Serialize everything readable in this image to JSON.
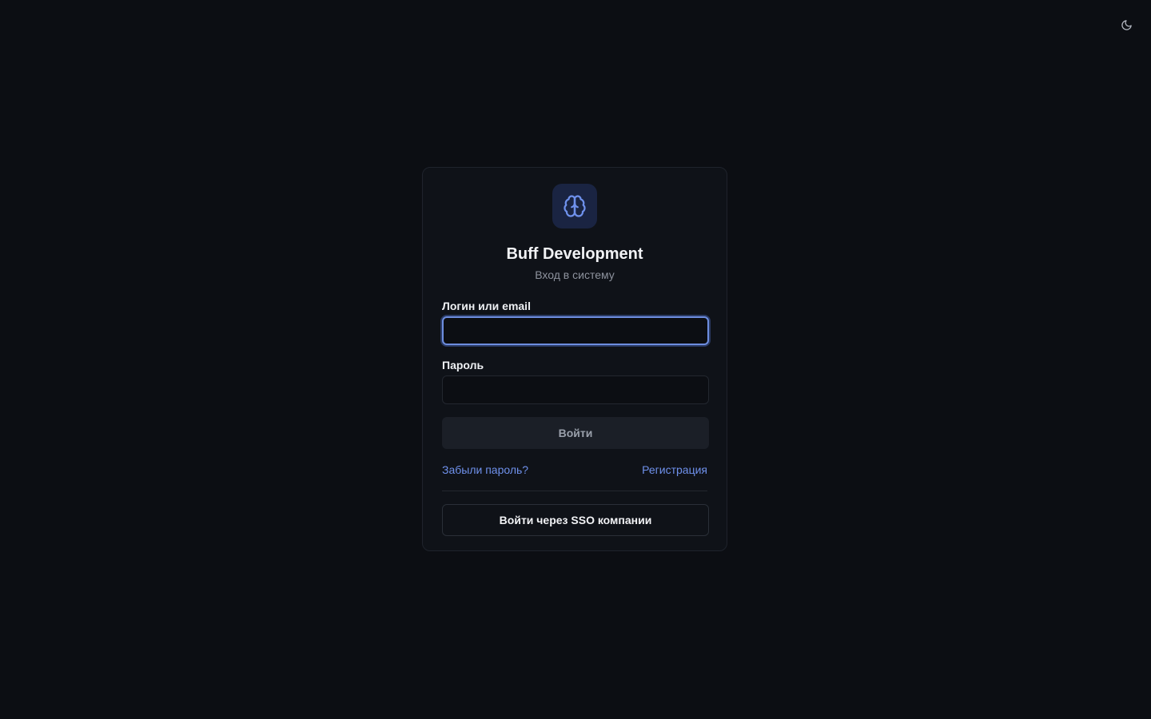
{
  "theme_toggle": {
    "icon": "moon-icon"
  },
  "app": {
    "logo_icon": "brain-icon",
    "title": "Buff Development",
    "subtitle": "Вход в систему"
  },
  "form": {
    "login_label": "Логин или email",
    "login_value": "",
    "password_label": "Пароль",
    "password_value": "",
    "submit_label": "Войти"
  },
  "links": {
    "forgot_password": "Забыли пароль?",
    "register": "Регистрация"
  },
  "sso": {
    "label": "Войти через SSO компании"
  },
  "colors": {
    "background": "#0c0e13",
    "card": "#0f1218",
    "accent": "#6f91ec",
    "logo_bg": "#1a2442"
  }
}
